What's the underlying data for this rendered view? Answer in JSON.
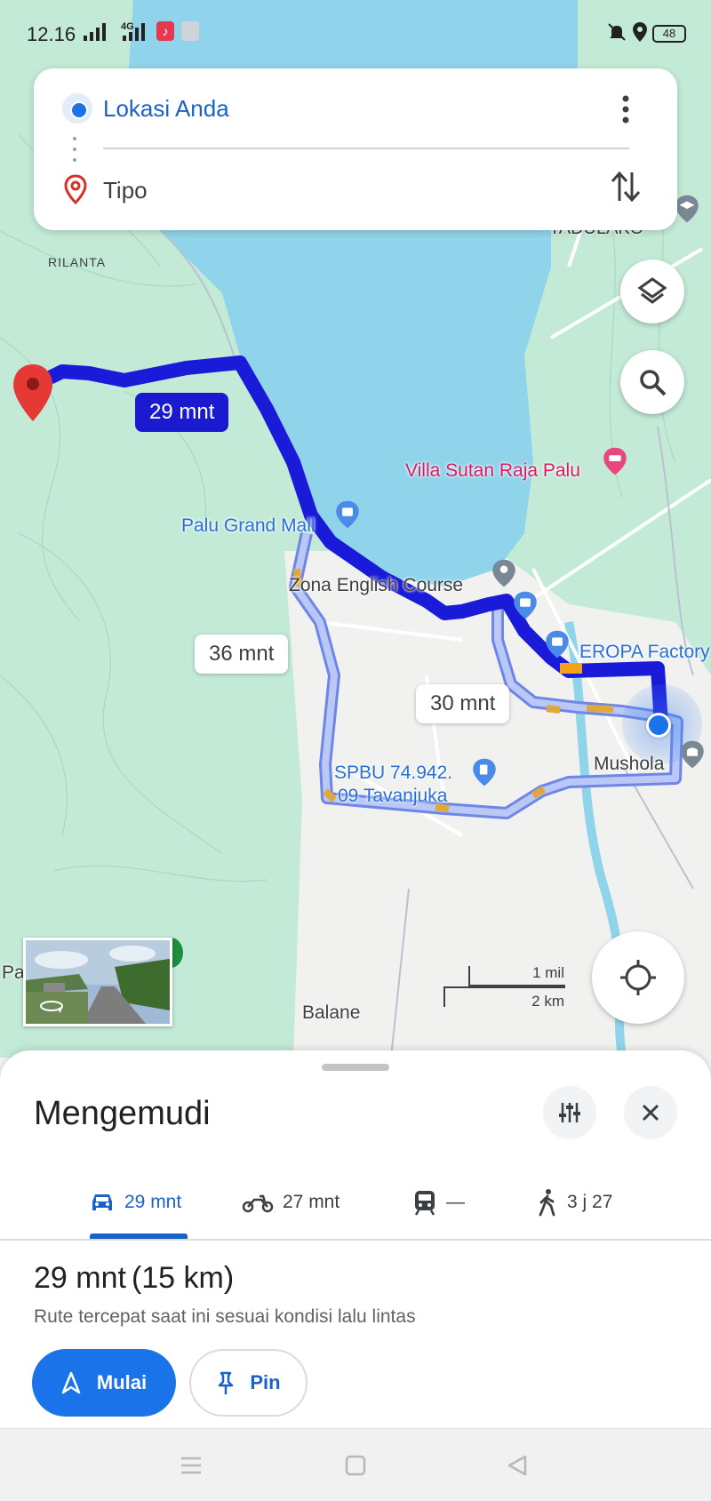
{
  "status_bar": {
    "time": "12.16",
    "network": "4G",
    "battery": "48",
    "icons": [
      "signal-icon",
      "signal-4g-icon",
      "music-app-icon",
      "notification-app-icon",
      "mute-icon",
      "location-icon",
      "battery-icon"
    ]
  },
  "route_card": {
    "origin": "Lokasi Anda",
    "destination": "Tipo",
    "icons": [
      "origin-dot-icon",
      "destination-pin-icon",
      "more-vert-icon",
      "swap-icon"
    ]
  },
  "map": {
    "labels": {
      "rilanta": "RILANTA",
      "tadulako": "TADULAKO",
      "villa": "Villa Sutan Raja Palu",
      "grand_mall": "Palu Grand Mall",
      "zona": "Zona English Course",
      "eropa": "EROPA Factory",
      "mushola": "Mushola",
      "spbu_line1": "SPBU 74.942.",
      "spbu_line2": "09 Tavanjuka",
      "balane": "Balane",
      "pa": "Pa"
    },
    "route_times": {
      "primary": "29 mnt",
      "alt1": "36 mnt",
      "alt2": "30 mnt"
    },
    "scale": {
      "imperial": "1 mil",
      "metric": "2 km"
    },
    "colors": {
      "water": "#8fd4ea",
      "land": "#bfe8d4",
      "route_primary": "#1a1ad9",
      "route_alt": "#aebff0",
      "traffic": "#e89b1c",
      "destination_pin": "#e53935"
    },
    "buttons": [
      "layers-icon",
      "search-icon",
      "my-location-icon",
      "street-view-icon"
    ]
  },
  "sheet": {
    "title": "Mengemudi",
    "modes": [
      {
        "icon": "car-icon",
        "label": "29 mnt"
      },
      {
        "icon": "motorcycle-icon",
        "label": "27 mnt"
      },
      {
        "icon": "transit-icon",
        "label": "—"
      },
      {
        "icon": "walk-icon",
        "label": "3 j 27"
      }
    ],
    "summary_time": "29 mnt",
    "summary_distance": "(15 km)",
    "description": "Rute tercepat saat ini sesuai kondisi lalu lintas",
    "start_label": "Mulai",
    "pin_label": "Pin"
  },
  "navbar": {
    "icons": [
      "menu-icon",
      "home-icon",
      "back-icon"
    ]
  }
}
